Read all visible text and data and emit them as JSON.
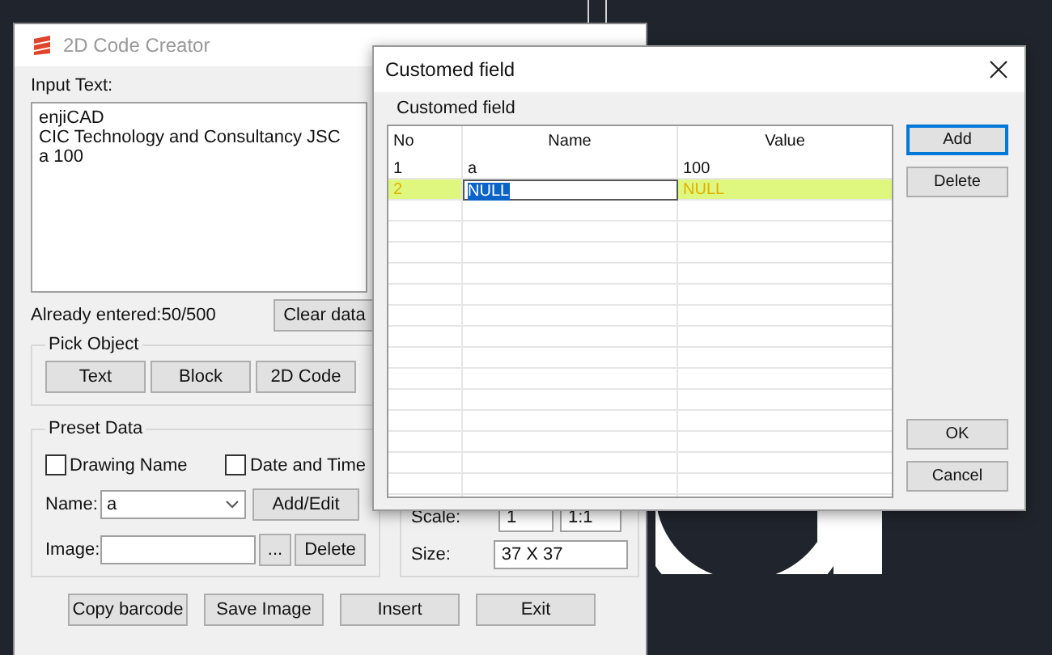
{
  "main_window": {
    "title": "2D Code Creator",
    "input_label": "Input Text:",
    "input_lines": [
      "enjiCAD",
      "CIC Technology and Consultancy JSC",
      "a 100"
    ],
    "counter": "Already entered:50/500",
    "clear_button": "Clear data",
    "pick_object": {
      "title": "Pick Object",
      "buttons": [
        "Text",
        "Block",
        "2D Code"
      ]
    },
    "preset_data": {
      "title": "Preset Data",
      "checkboxes": [
        {
          "label": "Drawing Name",
          "checked": false
        },
        {
          "label": "Date and Time",
          "checked": false
        }
      ],
      "name_label": "Name:",
      "name_value": "a",
      "add_edit_button": "Add/Edit",
      "image_label": "Image:",
      "browse_button": "...",
      "delete_button": "Delete"
    },
    "scale_label": "Scale:",
    "scale_value": "1",
    "ratio_value": "1:1",
    "size_label": "Size:",
    "size_value": "37 X 37",
    "bottom_buttons": [
      "Copy barcode",
      "Save Image",
      "Insert",
      "Exit"
    ]
  },
  "dialog": {
    "title": "Customed field",
    "group_label": "Customed field",
    "columns": [
      "No",
      "Name",
      "Value"
    ],
    "rows": [
      {
        "no": "1",
        "name": "a",
        "value": "100",
        "selected": false,
        "editing": false
      },
      {
        "no": "2",
        "name": "NULL",
        "value": "NULL",
        "selected": true,
        "editing": true
      }
    ],
    "buttons": [
      {
        "label": "Add",
        "default": true,
        "kind": "top"
      },
      {
        "label": "Delete",
        "default": false,
        "kind": "top"
      },
      {
        "label": "OK",
        "default": false,
        "kind": "bottom"
      },
      {
        "label": "Cancel",
        "default": false,
        "kind": "bottom"
      }
    ]
  }
}
